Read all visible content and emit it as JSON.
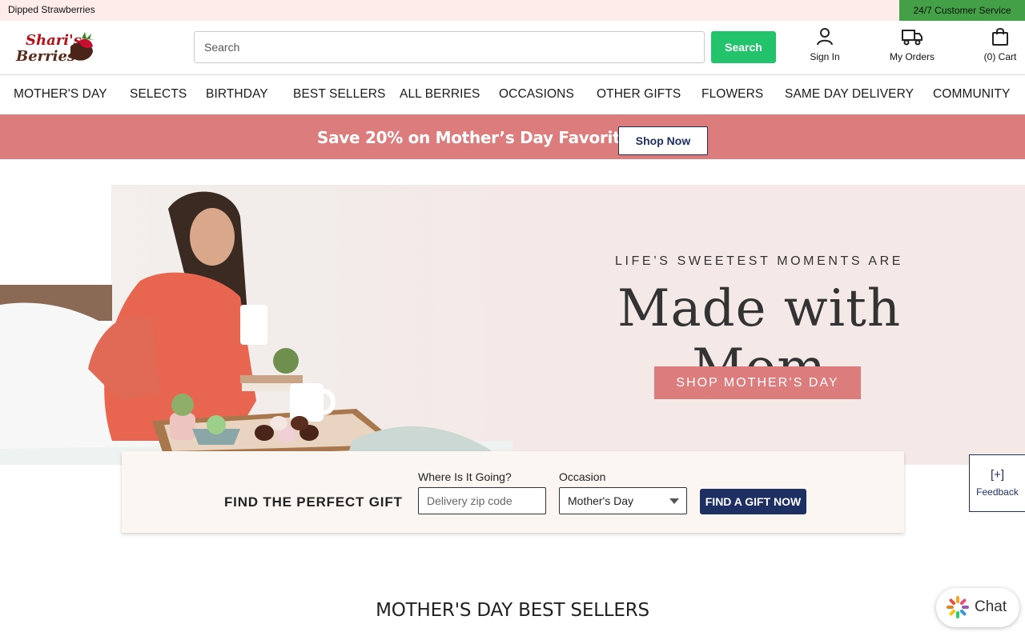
{
  "topbar": {
    "left_text": "Dipped Strawberries",
    "service_text": "24/7 Customer Service"
  },
  "header": {
    "logo": {
      "line1": "Shari's",
      "line2": "Berries",
      "name": "strawberry-logo"
    },
    "search_placeholder": "Search",
    "search_button": "Search",
    "sign_in": "Sign In",
    "my_orders": "My Orders",
    "cart": "(0) Cart"
  },
  "nav": {
    "items": [
      {
        "label": "MOTHER'S DAY"
      },
      {
        "label": "SELECTS"
      },
      {
        "label": "BIRTHDAY"
      },
      {
        "label": "BEST SELLERS"
      },
      {
        "label": "ALL BERRIES"
      },
      {
        "label": "OCCASIONS"
      },
      {
        "label": "OTHER GIFTS"
      },
      {
        "label": "FLOWERS"
      },
      {
        "label": "SAME DAY DELIVERY"
      },
      {
        "label": "COMMUNITY"
      }
    ]
  },
  "promo": {
    "message": "Save 20% on Mother’s Day Favorites!",
    "button": "Shop Now"
  },
  "hero": {
    "eyebrow": "LIFE’S SWEETEST MOMENTS ARE",
    "headline": "Made with Mom",
    "cta": "SHOP MOTHER’S DAY"
  },
  "gift_finder": {
    "title": "FIND THE PERFECT GIFT",
    "zip_label": "Where Is It Going?",
    "zip_placeholder": "Delivery zip code",
    "occasion_label": "Occasion",
    "occasion_value": "Mother's Day",
    "button": "FIND A GIFT NOW"
  },
  "feedback": {
    "icon": "[+]",
    "label": "Feedback"
  },
  "section": {
    "title": "MOTHER'S DAY BEST SELLERS"
  },
  "chat": {
    "label": "Chat"
  },
  "colors": {
    "brand_pink": "#dc7c7c",
    "navy": "#1d2f63",
    "green": "#22c36b",
    "hero_bg": "#f5e9e8"
  }
}
